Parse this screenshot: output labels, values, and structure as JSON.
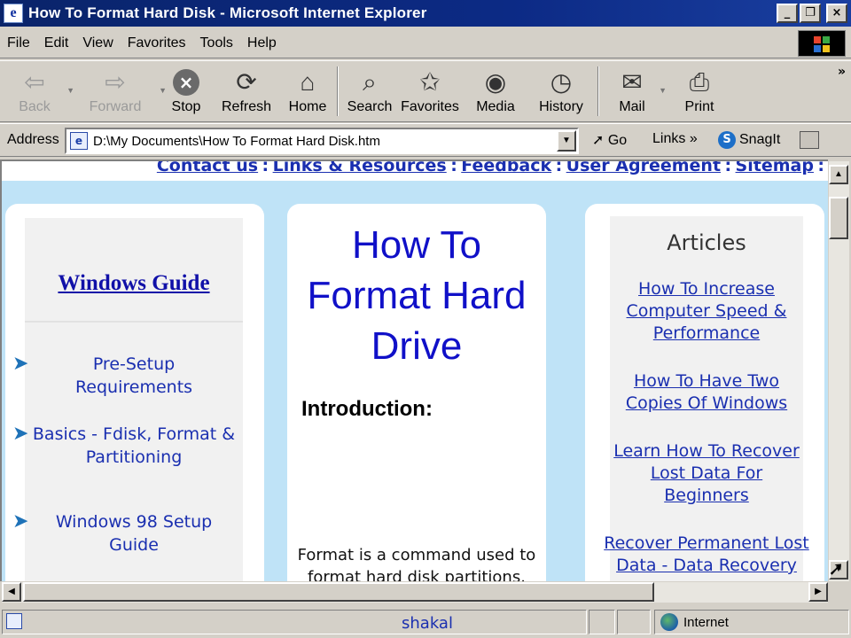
{
  "window": {
    "title": "How To Format Hard Disk - Microsoft Internet Explorer",
    "icon": "ie-page-icon",
    "controls": [
      "_",
      "❐",
      "×"
    ]
  },
  "menu": [
    "File",
    "Edit",
    "View",
    "Favorites",
    "Tools",
    "Help"
  ],
  "toolbar": {
    "back": "Back",
    "forward": "Forward",
    "stop": "Stop",
    "refresh": "Refresh",
    "home": "Home",
    "search": "Search",
    "favorites": "Favorites",
    "media": "Media",
    "history": "History",
    "mail": "Mail",
    "print": "Print",
    "more": "»"
  },
  "address": {
    "label": "Address",
    "url": "D:\\My Documents\\How To Format Hard Disk.htm",
    "go": "Go",
    "links": "Links",
    "links_more": "»",
    "snagit": "SnagIt"
  },
  "page": {
    "top_nav": [
      "Contact us",
      "Links & Resources",
      "Feedback",
      "User Agreement",
      "Sitemap"
    ],
    "left": {
      "heading": "Windows Guide",
      "items": [
        "Pre-Setup Requirements",
        "Basics - Fdisk, Format & Partitioning",
        "Windows 98 Setup Guide"
      ]
    },
    "center": {
      "title": "How To Format Hard Drive",
      "intro_heading": "Introduction:",
      "intro_text": "Format is a command used to format hard disk partitions. This is used when you want to delete everything from a"
    },
    "right": {
      "heading": "Articles",
      "items": [
        "How To Increase Computer Speed & Performance",
        "How To Have Two Copies Of Windows",
        "Learn How To Recover Lost Data For Beginners",
        "Recover Permanent Lost Data - Data Recovery"
      ]
    }
  },
  "status": {
    "text": "shakal",
    "zone": "Internet"
  },
  "colors": {
    "titlebar": "#0a246a",
    "link": "#1a2fb0",
    "page_bg": "#bfe3f7",
    "heading_blue": "#1010c8"
  }
}
